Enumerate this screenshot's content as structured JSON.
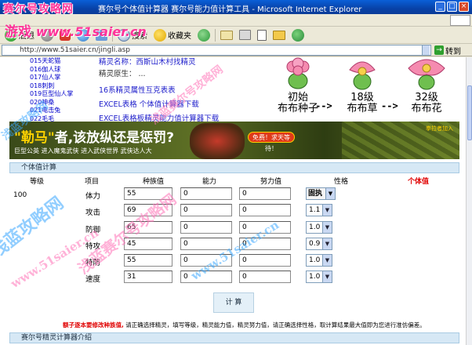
{
  "window": {
    "watermark_logo": "赛尔号攻略网",
    "title": "赛尔号个体值计算器 赛尔号能力值计算工具 - Microsoft Internet Explorer",
    "controls": [
      "_",
      "□",
      "×"
    ]
  },
  "toolbar": {
    "back_label": "后退",
    "search_label": "搜索",
    "favorites_label": "收藏夹"
  },
  "address": {
    "value": "http://www.51saier.cn/jingli.asp",
    "go_label": "转到"
  },
  "site_watermark": {
    "name": "游戏",
    "url": "www.51saier.cn"
  },
  "left_list": [
    "015天蛇猫",
    "016伽人球",
    "017仙人掌",
    "018刺刺",
    "019巨型仙人掌",
    "020神桑",
    "021电击兔",
    "022毛毛"
  ],
  "mid_links": [
    {
      "text": "精灵名称：西斯山木村找精灵"
    },
    {
      "text": "精灵原生：  ..."
    },
    {
      "text": "16系精灵属性互克表表"
    },
    {
      "text": "EXCEL表格 个体值计算器下载"
    },
    {
      "text": "EXCEL表格板精灵能力值计算器下载"
    }
  ],
  "evolution": {
    "stages": [
      {
        "line1": "初始",
        "line2": "布布种子"
      },
      {
        "line1": "18级",
        "line2": "布布草"
      },
      {
        "line1": "32级",
        "line2": "布布花"
      }
    ],
    "arrow": "-->"
  },
  "banner": {
    "headline_q": "\"勒马\"",
    "headline_rest": "者,该放纵还是惩罚?",
    "subline": "巨型公英  进入魔鬼武侠  进入武侠世界  武侠达人大",
    "enter_label": "免费！求天等待！",
    "corner": "拳拉者加入"
  },
  "calculator": {
    "header": "个体值计算",
    "columns": {
      "level": "等级",
      "item": "项目",
      "base": "种族值",
      "ability": "能力",
      "effort": "努力值",
      "nature": "性格",
      "iv": "个体值"
    },
    "level_value": "100",
    "nature_selected": "固执",
    "rows": [
      {
        "name": "体力",
        "base": "55",
        "ability": "0",
        "effort": "0",
        "modifier": null
      },
      {
        "name": "攻击",
        "base": "69",
        "ability": "0",
        "effort": "0",
        "modifier": "1.1"
      },
      {
        "name": "防御",
        "base": "65",
        "ability": "0",
        "effort": "0",
        "modifier": "1.0"
      },
      {
        "name": "特攻",
        "base": "45",
        "ability": "0",
        "effort": "0",
        "modifier": "0.9"
      },
      {
        "name": "特防",
        "base": "55",
        "ability": "0",
        "effort": "0",
        "modifier": "1.0"
      },
      {
        "name": "速度",
        "base": "31",
        "ability": "0",
        "effort": "0",
        "modifier": "1.0"
      }
    ],
    "submit_label": "计 算"
  },
  "note": {
    "red_part": "额子逐本要修改种族值,",
    "rest": " 请正确选择精灵，填写等级，精灵能力值，精灵努力值，请正确选择性格，取计算结果最大值即为您进行准仿偏差。"
  },
  "intro_header": "赛尔号精灵计算器介绍",
  "watermarks": {
    "blue_cn": "浅蓝攻略网",
    "pink_url": "www.51saier.cn",
    "blue_url": "www.51saier.cn",
    "pink_cn": "浅蓝赛尔号攻略网"
  }
}
